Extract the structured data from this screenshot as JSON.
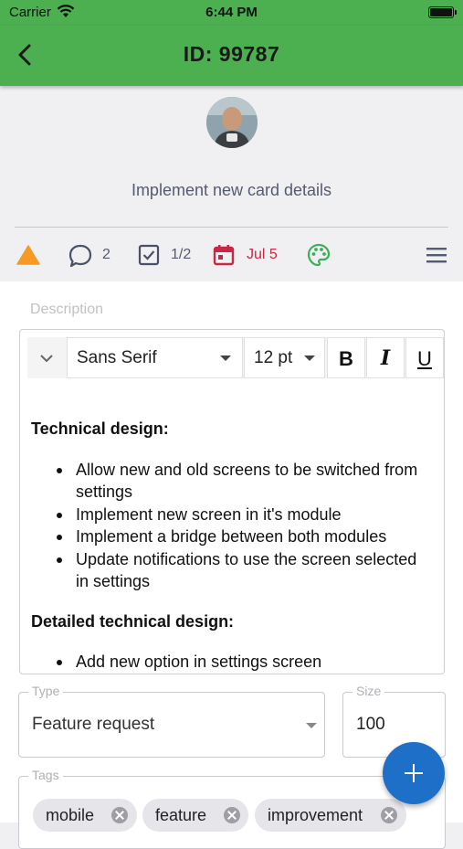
{
  "status_bar": {
    "carrier": "Carrier",
    "time": "6:44 PM"
  },
  "app_bar": {
    "title": "ID: 99787"
  },
  "card": {
    "title": "Implement new card details",
    "comments_count": "2",
    "checklist": "1/2",
    "due_date": "Jul 5"
  },
  "colors": {
    "accent": "#4caf50",
    "warning": "#f59a23",
    "due_date": "#c62845",
    "palette": "#3fae5a",
    "fab": "#1e6fc8"
  },
  "description": {
    "label": "Description",
    "toolbar": {
      "font": "Sans Serif",
      "size": "12 pt",
      "bold": "B",
      "italic": "I",
      "underline": "U"
    },
    "heading1": "Technical design:",
    "bullets1": [
      "Allow new and old screens to be switched from settings",
      "Implement new screen in it's module",
      "Implement a bridge between both modules",
      "Update notifications to use the screen selected in settings"
    ],
    "heading2": "Detailed technical design:",
    "bullets2": [
      "Add new option in settings screen"
    ]
  },
  "type_field": {
    "label": "Type",
    "value": "Feature request"
  },
  "size_field": {
    "label": "Size",
    "value": "100"
  },
  "tags_field": {
    "label": "Tags",
    "tags": [
      "mobile",
      "feature",
      "improvement"
    ]
  },
  "icons": [
    "back-arrow-icon",
    "warning-icon",
    "comment-icon",
    "checkbox-icon",
    "calendar-icon",
    "palette-icon",
    "menu-icon",
    "chevron-down-icon",
    "remove-tag-icon",
    "plus-icon"
  ]
}
